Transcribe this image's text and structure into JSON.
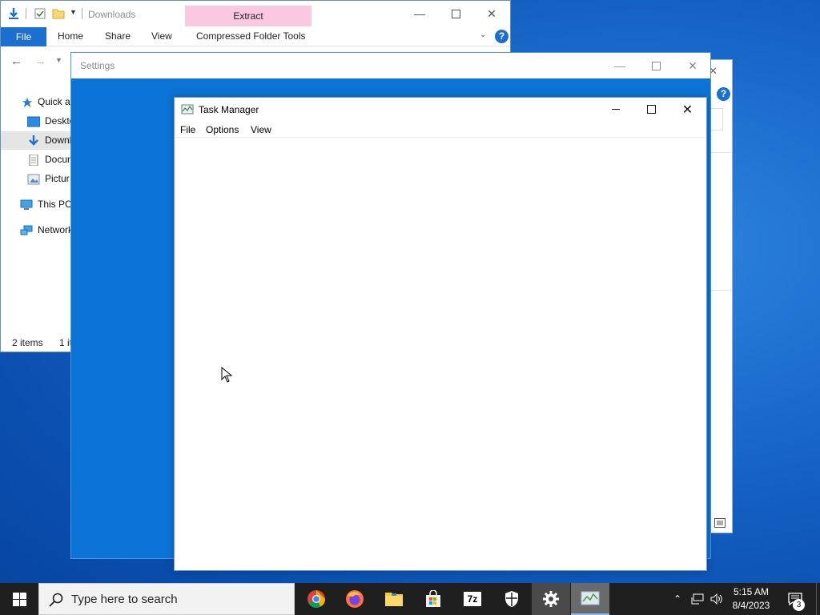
{
  "explorer": {
    "title": "Downloads",
    "contextual_tab": "Extract",
    "contextual_group": "Compressed Folder Tools",
    "ribbon_tabs": [
      "File",
      "Home",
      "Share",
      "View"
    ],
    "nav_items": [
      "Quick a",
      "Deskto",
      "Downl",
      "Docun",
      "Pictur",
      "This PC",
      "Network"
    ],
    "status_items": "2 items",
    "status_selected": "1 it"
  },
  "settings": {
    "title": "Settings"
  },
  "taskmgr": {
    "title": "Task Manager",
    "menu": [
      "File",
      "Options",
      "View"
    ]
  },
  "taskbar": {
    "search_placeholder": "Type here to search",
    "time": "5:15 AM",
    "date": "8/4/2023",
    "notification_count": "3",
    "seven_zip_label": "7z"
  },
  "colors": {
    "accent": "#1a6fd0",
    "settings_bg": "#0c74d6",
    "context_tab": "#fbc8e2",
    "taskbar": "#1f1f1f"
  }
}
